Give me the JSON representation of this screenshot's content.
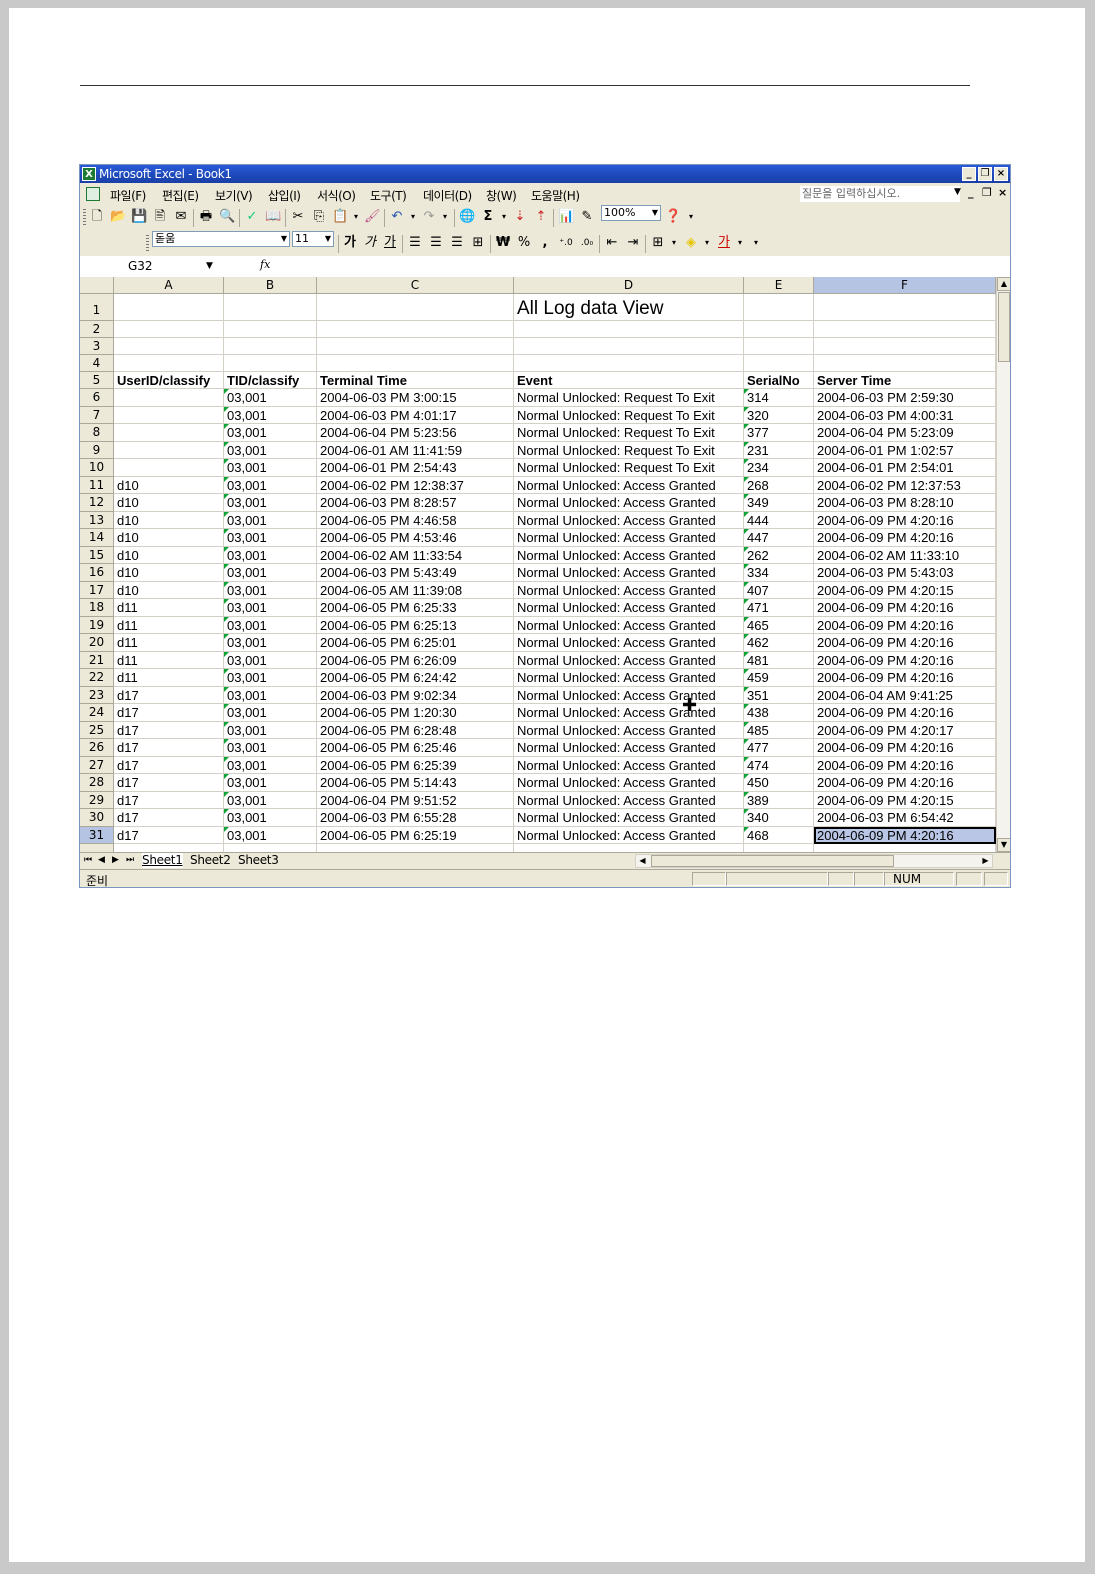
{
  "window": {
    "title": "Microsoft Excel - Book1",
    "icon": "excel-icon"
  },
  "menu": {
    "items": [
      "파일(F)",
      "편집(E)",
      "보기(V)",
      "삽입(I)",
      "서식(O)",
      "도구(T)",
      "데이터(D)",
      "창(W)",
      "도움말(H)"
    ],
    "question_placeholder": "질문을 입력하십시오."
  },
  "toolbar": {
    "zoom": "100%"
  },
  "format": {
    "font": "돋움",
    "size": "11"
  },
  "formula_bar": {
    "name_box": "G32",
    "fx": "fx"
  },
  "columns": [
    "A",
    "B",
    "C",
    "D",
    "E",
    "F"
  ],
  "selected_column": "F",
  "title_cell": "All Log data View",
  "headers": [
    "UserID/classify",
    "TID/classify",
    "Terminal Time",
    "Event",
    "SerialNo",
    "Server Time"
  ],
  "rows": [
    {
      "n": "6",
      "user": "",
      "tid": "03,001",
      "term": "2004-06-03 PM 3:00:15",
      "event": "Normal Unlocked: Request To Exit",
      "serial": "314",
      "server": "2004-06-03 PM 2:59:30"
    },
    {
      "n": "7",
      "user": "",
      "tid": "03,001",
      "term": "2004-06-03 PM 4:01:17",
      "event": "Normal Unlocked: Request To Exit",
      "serial": "320",
      "server": "2004-06-03 PM 4:00:31"
    },
    {
      "n": "8",
      "user": "",
      "tid": "03,001",
      "term": "2004-06-04 PM 5:23:56",
      "event": "Normal Unlocked: Request To Exit",
      "serial": "377",
      "server": "2004-06-04 PM 5:23:09"
    },
    {
      "n": "9",
      "user": "",
      "tid": "03,001",
      "term": "2004-06-01 AM 11:41:59",
      "event": "Normal Unlocked: Request To Exit",
      "serial": "231",
      "server": "2004-06-01 PM 1:02:57"
    },
    {
      "n": "10",
      "user": "",
      "tid": "03,001",
      "term": "2004-06-01 PM 2:54:43",
      "event": "Normal Unlocked: Request To Exit",
      "serial": "234",
      "server": "2004-06-01 PM 2:54:01"
    },
    {
      "n": "11",
      "user": "d10",
      "tid": "03,001",
      "term": "2004-06-02 PM 12:38:37",
      "event": "Normal Unlocked: Access Granted",
      "serial": "268",
      "server": "2004-06-02 PM 12:37:53"
    },
    {
      "n": "12",
      "user": "d10",
      "tid": "03,001",
      "term": "2004-06-03 PM 8:28:57",
      "event": "Normal Unlocked: Access Granted",
      "serial": "349",
      "server": "2004-06-03 PM 8:28:10"
    },
    {
      "n": "13",
      "user": "d10",
      "tid": "03,001",
      "term": "2004-06-05 PM 4:46:58",
      "event": "Normal Unlocked: Access Granted",
      "serial": "444",
      "server": "2004-06-09 PM 4:20:16"
    },
    {
      "n": "14",
      "user": "d10",
      "tid": "03,001",
      "term": "2004-06-05 PM 4:53:46",
      "event": "Normal Unlocked: Access Granted",
      "serial": "447",
      "server": "2004-06-09 PM 4:20:16"
    },
    {
      "n": "15",
      "user": "d10",
      "tid": "03,001",
      "term": "2004-06-02 AM 11:33:54",
      "event": "Normal Unlocked: Access Granted",
      "serial": "262",
      "server": "2004-06-02 AM 11:33:10"
    },
    {
      "n": "16",
      "user": "d10",
      "tid": "03,001",
      "term": "2004-06-03 PM 5:43:49",
      "event": "Normal Unlocked: Access Granted",
      "serial": "334",
      "server": "2004-06-03 PM 5:43:03"
    },
    {
      "n": "17",
      "user": "d10",
      "tid": "03,001",
      "term": "2004-06-05 AM 11:39:08",
      "event": "Normal Unlocked: Access Granted",
      "serial": "407",
      "server": "2004-06-09 PM 4:20:15"
    },
    {
      "n": "18",
      "user": "d11",
      "tid": "03,001",
      "term": "2004-06-05 PM 6:25:33",
      "event": "Normal Unlocked: Access Granted",
      "serial": "471",
      "server": "2004-06-09 PM 4:20:16"
    },
    {
      "n": "19",
      "user": "d11",
      "tid": "03,001",
      "term": "2004-06-05 PM 6:25:13",
      "event": "Normal Unlocked: Access Granted",
      "serial": "465",
      "server": "2004-06-09 PM 4:20:16"
    },
    {
      "n": "20",
      "user": "d11",
      "tid": "03,001",
      "term": "2004-06-05 PM 6:25:01",
      "event": "Normal Unlocked: Access Granted",
      "serial": "462",
      "server": "2004-06-09 PM 4:20:16"
    },
    {
      "n": "21",
      "user": "d11",
      "tid": "03,001",
      "term": "2004-06-05 PM 6:26:09",
      "event": "Normal Unlocked: Access Granted",
      "serial": "481",
      "server": "2004-06-09 PM 4:20:16"
    },
    {
      "n": "22",
      "user": "d11",
      "tid": "03,001",
      "term": "2004-06-05 PM 6:24:42",
      "event": "Normal Unlocked: Access Granted",
      "serial": "459",
      "server": "2004-06-09 PM 4:20:16"
    },
    {
      "n": "23",
      "user": "d17",
      "tid": "03,001",
      "term": "2004-06-03 PM 9:02:34",
      "event": "Normal Unlocked: Access Granted",
      "serial": "351",
      "server": "2004-06-04 AM 9:41:25"
    },
    {
      "n": "24",
      "user": "d17",
      "tid": "03,001",
      "term": "2004-06-05 PM 1:20:30",
      "event": "Normal Unlocked: Access Granted",
      "serial": "438",
      "server": "2004-06-09 PM 4:20:16"
    },
    {
      "n": "25",
      "user": "d17",
      "tid": "03,001",
      "term": "2004-06-05 PM 6:28:48",
      "event": "Normal Unlocked: Access Granted",
      "serial": "485",
      "server": "2004-06-09 PM 4:20:17"
    },
    {
      "n": "26",
      "user": "d17",
      "tid": "03,001",
      "term": "2004-06-05 PM 6:25:46",
      "event": "Normal Unlocked: Access Granted",
      "serial": "477",
      "server": "2004-06-09 PM 4:20:16"
    },
    {
      "n": "27",
      "user": "d17",
      "tid": "03,001",
      "term": "2004-06-05 PM 6:25:39",
      "event": "Normal Unlocked: Access Granted",
      "serial": "474",
      "server": "2004-06-09 PM 4:20:16"
    },
    {
      "n": "28",
      "user": "d17",
      "tid": "03,001",
      "term": "2004-06-05 PM 5:14:43",
      "event": "Normal Unlocked: Access Granted",
      "serial": "450",
      "server": "2004-06-09 PM 4:20:16"
    },
    {
      "n": "29",
      "user": "d17",
      "tid": "03,001",
      "term": "2004-06-04 PM 9:51:52",
      "event": "Normal Unlocked: Access Granted",
      "serial": "389",
      "server": "2004-06-09 PM 4:20:15"
    },
    {
      "n": "30",
      "user": "d17",
      "tid": "03,001",
      "term": "2004-06-03 PM 6:55:28",
      "event": "Normal Unlocked: Access Granted",
      "serial": "340",
      "server": "2004-06-03 PM 6:54:42"
    },
    {
      "n": "31",
      "user": "d17",
      "tid": "03,001",
      "term": "2004-06-05 PM 6:25:19",
      "event": "Normal Unlocked: Access Granted",
      "serial": "468",
      "server": "2004-06-09 PM 4:20:16"
    }
  ],
  "sheets": [
    "Sheet1",
    "Sheet2",
    "Sheet3"
  ],
  "active_sheet": "Sheet1",
  "status": {
    "ready": "준비",
    "num": "NUM"
  },
  "colors": {
    "selection": "#b9c6e6",
    "title_bar": "#1c48b9",
    "comment_marker": "#11a335"
  }
}
